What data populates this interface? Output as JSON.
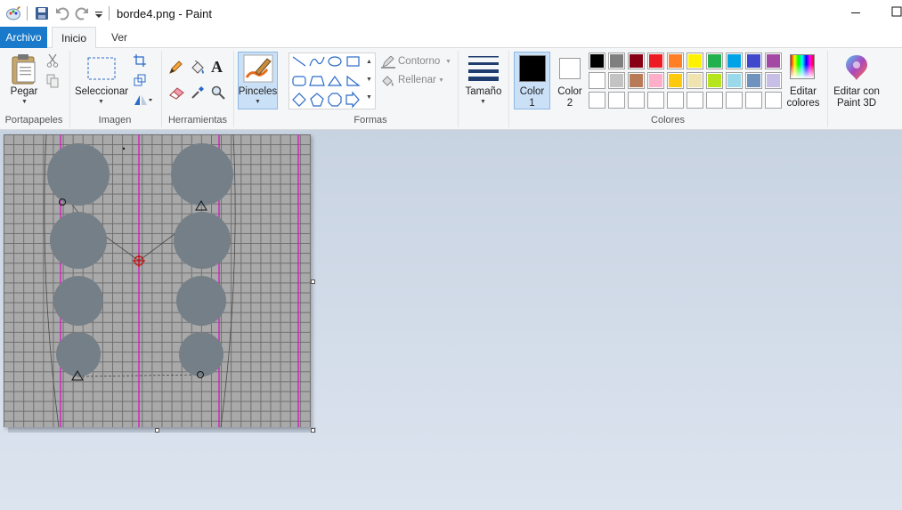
{
  "window": {
    "title": "borde4.png - Paint"
  },
  "tabs": [
    {
      "label": "Archivo"
    },
    {
      "label": "Inicio"
    },
    {
      "label": "Ver"
    }
  ],
  "ribbon": {
    "portapapeles": {
      "group": "Portapapeles",
      "paste": "Pegar"
    },
    "imagen": {
      "group": "Imagen",
      "select": "Seleccionar"
    },
    "herramientas": {
      "group": "Herramientas"
    },
    "pinceles": {
      "label": "Pinceles"
    },
    "formas": {
      "group": "Formas",
      "contorno": "Contorno",
      "rellenar": "Rellenar"
    },
    "tamano": {
      "label": "Tamaño"
    },
    "colores": {
      "group": "Colores",
      "color1": {
        "line1": "Color",
        "line2": "1",
        "value": "#000000"
      },
      "color2": {
        "line1": "Color",
        "line2": "2",
        "value": "#ffffff"
      },
      "edit": {
        "line1": "Editar",
        "line2": "colores"
      },
      "palette_row1": [
        "#000000",
        "#7f7f7f",
        "#880015",
        "#ed1c24",
        "#ff7f27",
        "#fff200",
        "#22b14c",
        "#00a2e8",
        "#3f48cc",
        "#a349a4"
      ],
      "palette_row2": [
        "#ffffff",
        "#c3c3c3",
        "#b97a57",
        "#ffaec9",
        "#ffc90e",
        "#efe4b0",
        "#b5e61d",
        "#99d9ea",
        "#7092be",
        "#c8bfe7"
      ],
      "palette_row3": [
        "#ffffff",
        "#ffffff",
        "#ffffff",
        "#ffffff",
        "#ffffff",
        "#ffffff",
        "#ffffff",
        "#ffffff",
        "#ffffff",
        "#ffffff"
      ]
    },
    "paint3d": {
      "line1": "Editar con",
      "line2": "Paint 3D"
    }
  }
}
